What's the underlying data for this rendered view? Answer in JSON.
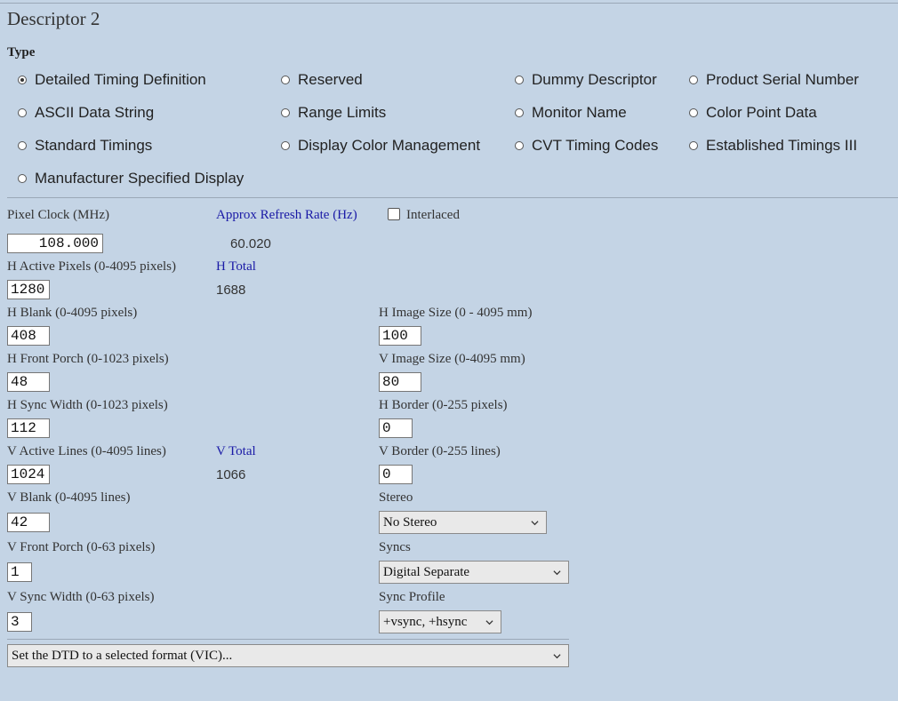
{
  "title": "Descriptor 2",
  "type_label": "Type",
  "radios": [
    {
      "label": "Detailed Timing Definition",
      "checked": true
    },
    {
      "label": "Reserved",
      "checked": false
    },
    {
      "label": "Dummy Descriptor",
      "checked": false
    },
    {
      "label": "Product Serial Number",
      "checked": false
    },
    {
      "label": "ASCII Data String",
      "checked": false
    },
    {
      "label": "Range Limits",
      "checked": false
    },
    {
      "label": "Monitor Name",
      "checked": false
    },
    {
      "label": "Color Point Data",
      "checked": false
    },
    {
      "label": "Standard Timings",
      "checked": false
    },
    {
      "label": "Display Color Management",
      "checked": false
    },
    {
      "label": "CVT Timing Codes",
      "checked": false
    },
    {
      "label": "Established Timings III",
      "checked": false
    },
    {
      "label": "Manufacturer Specified Display",
      "checked": false
    }
  ],
  "fields": {
    "pixel_clock": {
      "label": "Pixel Clock (MHz)",
      "value": "108.000"
    },
    "refresh_rate": {
      "label": "Approx Refresh Rate (Hz)",
      "value": "60.020"
    },
    "interlaced": {
      "label": "Interlaced",
      "checked": false
    },
    "h_active": {
      "label": "H Active Pixels (0-4095 pixels)",
      "value": "1280"
    },
    "h_total": {
      "label": "H Total",
      "value": "1688"
    },
    "h_blank": {
      "label": "H Blank (0-4095 pixels)",
      "value": "408"
    },
    "h_image_size": {
      "label": "H Image Size (0 - 4095 mm)",
      "value": "100"
    },
    "h_front_porch": {
      "label": "H Front Porch (0-1023 pixels)",
      "value": "48"
    },
    "v_image_size": {
      "label": "V Image Size (0-4095 mm)",
      "value": "80"
    },
    "h_sync_width": {
      "label": "H Sync Width (0-1023 pixels)",
      "value": "112"
    },
    "h_border": {
      "label": "H Border (0-255 pixels)",
      "value": "0"
    },
    "v_active": {
      "label": "V Active Lines (0-4095 lines)",
      "value": "1024"
    },
    "v_total": {
      "label": "V Total",
      "value": "1066"
    },
    "v_border": {
      "label": "V Border (0-255 lines)",
      "value": "0"
    },
    "v_blank": {
      "label": "V Blank (0-4095 lines)",
      "value": "42"
    },
    "stereo": {
      "label": "Stereo",
      "value": "No Stereo"
    },
    "v_front_porch": {
      "label": "V Front Porch (0-63 pixels)",
      "value": "1"
    },
    "syncs": {
      "label": "Syncs",
      "value": "Digital Separate"
    },
    "v_sync_width": {
      "label": "V Sync Width (0-63 pixels)",
      "value": "3"
    },
    "sync_profile": {
      "label": "Sync Profile",
      "value": "+vsync, +hsync"
    }
  },
  "vic_select": {
    "value": "Set the DTD to a selected format (VIC)..."
  },
  "icons": {
    "dropdown": "chevron-down-icon"
  }
}
